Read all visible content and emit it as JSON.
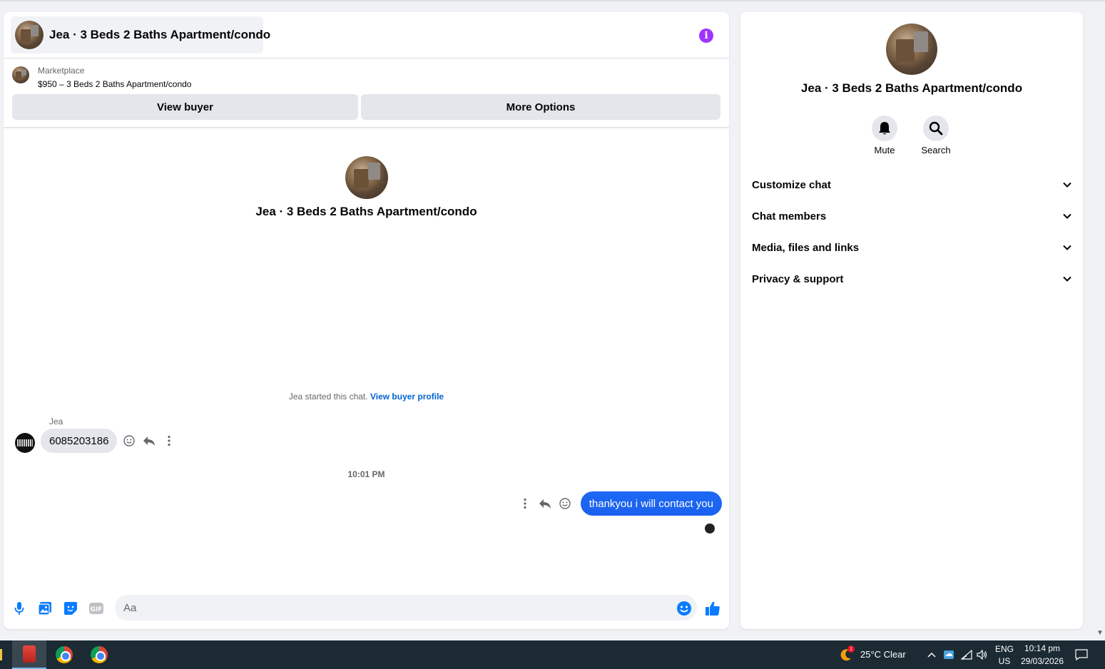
{
  "chat": {
    "title": "Jea · 3 Beds 2 Baths Apartment/condo",
    "listing": {
      "label": "Marketplace",
      "price_title": "$950 – 3 Beds 2 Baths Apartment/condo",
      "view_buyer_label": "View buyer",
      "more_options_label": "More Options"
    },
    "intro_name": "Jea · 3 Beds 2 Baths Apartment/condo",
    "started_text": "Jea started this chat.",
    "started_link": "View buyer profile",
    "messages": [
      {
        "sender": "Jea",
        "text": "6085203186"
      },
      {
        "timestamp": "10:01 PM"
      },
      {
        "text": "thankyou i will contact you"
      }
    ],
    "composer_placeholder": "Aa"
  },
  "side": {
    "name": "Jea · 3 Beds 2 Baths Apartment/condo",
    "actions": [
      {
        "label": "Mute",
        "icon": "bell-icon"
      },
      {
        "label": "Search",
        "icon": "search-icon"
      }
    ],
    "sections": [
      {
        "label": "Customize chat"
      },
      {
        "label": "Chat members"
      },
      {
        "label": "Media, files and links"
      },
      {
        "label": "Privacy & support"
      }
    ]
  },
  "taskbar": {
    "weather": "25°C  Clear",
    "weather_badge": "1",
    "lang_top": "ENG",
    "lang_bottom": "US",
    "time": "10:14 pm",
    "date": "29/03/2026"
  },
  "colors": {
    "accent": "#0a7cff",
    "info": "#a033ff",
    "link": "#0064d1"
  }
}
